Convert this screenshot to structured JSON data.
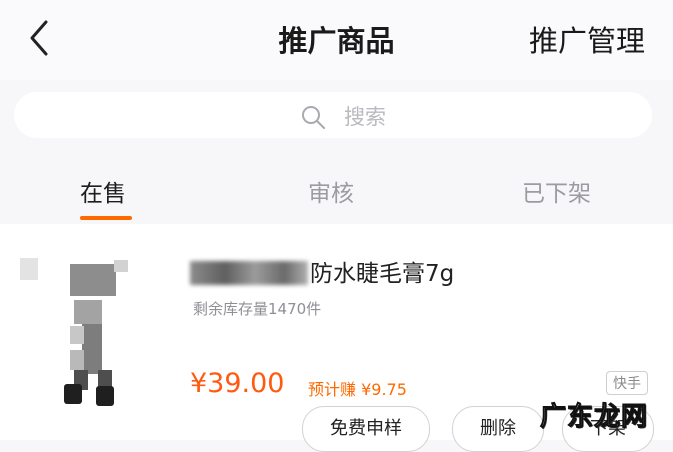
{
  "header": {
    "title": "推广商品",
    "manage_label": "推广管理"
  },
  "search": {
    "placeholder": "搜索"
  },
  "tabs": [
    {
      "label": "在售",
      "active": true
    },
    {
      "label": "审核",
      "active": false
    },
    {
      "label": "已下架",
      "active": false
    }
  ],
  "product": {
    "title_visible": "防水睫毛膏7g",
    "stock": "剩余库存量1470件",
    "price": "¥39.00",
    "commission": "预计赚 ¥9.75",
    "platform": "快手",
    "buttons": {
      "sample": "免费申样",
      "delete": "删除",
      "offshelf": "下架"
    }
  },
  "watermark": "广东龙网",
  "colors": {
    "accent": "#ff6a00",
    "price": "#ff5a10"
  }
}
